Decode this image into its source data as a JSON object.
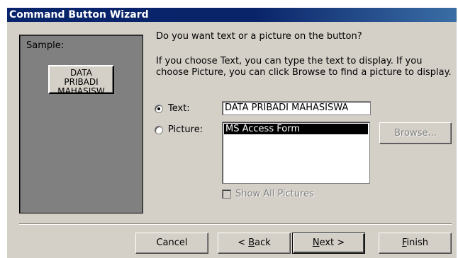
{
  "window": {
    "title": "Command Button Wizard"
  },
  "sample": {
    "label": "Sample:",
    "button_text": "DATA PRIBADI MAHASISWA"
  },
  "question": "Do you want text or a picture on the button?",
  "instructions": "If you choose Text, you can type the text to display.  If you choose Picture, you can click Browse to find a picture to display.",
  "options": {
    "text": {
      "label": "Text:",
      "selected": true,
      "value": "DATA PRIBADI MAHASISWA"
    },
    "picture": {
      "label": "Picture:",
      "selected": false,
      "items": [
        "MS Access Form"
      ],
      "selected_item": "MS Access Form"
    }
  },
  "browse_label": "Browse...",
  "show_all_label": "Show All Pictures",
  "buttons": {
    "cancel": "Cancel",
    "back_prefix": "< ",
    "back_key": "B",
    "back_rest": "ack",
    "next_key": "N",
    "next_rest": "ext >",
    "finish_key": "F",
    "finish_rest": "inish"
  }
}
